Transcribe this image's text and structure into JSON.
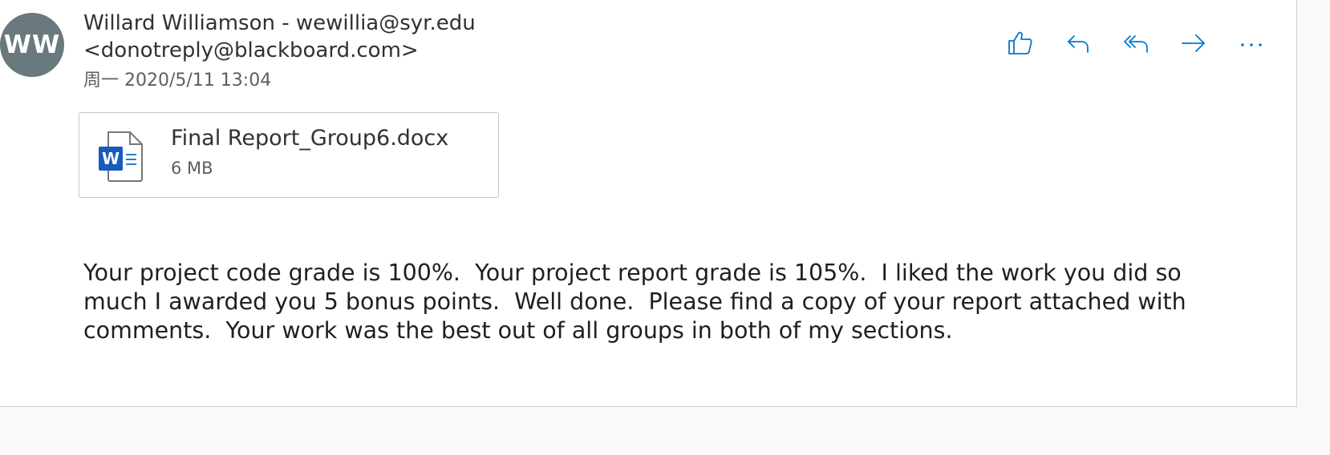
{
  "message": {
    "avatar_initials": "WW",
    "avatar_color": "#69797e",
    "sender": "Willard Williamson - wewillia@syr.edu <donotreply@blackboard.com>",
    "date": "周一 2020/5/11 13:04",
    "actions": [
      {
        "name": "like",
        "icon": "thumbs-up-icon"
      },
      {
        "name": "reply",
        "icon": "reply-icon"
      },
      {
        "name": "reply-all",
        "icon": "reply-all-icon"
      },
      {
        "name": "forward",
        "icon": "forward-icon"
      },
      {
        "name": "more",
        "icon": "more-icon"
      }
    ],
    "accent_color": "#0078d4",
    "attachment": {
      "name": "Final Report_Group6.docx",
      "size": "6 MB",
      "icon": "word-document-icon"
    },
    "body": "Your project code grade is 100%.  Your project report grade is 105%.  I liked the work you did so much I awarded you 5 bonus points.  Well done.  Please find a copy of your report attached with comments.  Your work was the best out of all groups in both of my sections."
  }
}
